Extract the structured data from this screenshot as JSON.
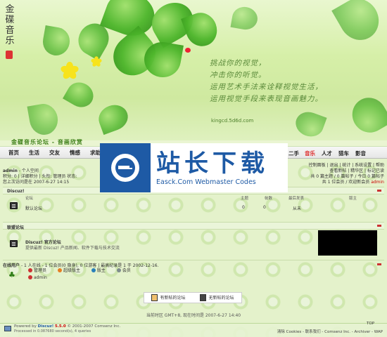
{
  "banner": {
    "logo_vertical": "金碟音乐",
    "slogan_lines": [
      "挑战你的视觉，",
      "冲击你的听觉。",
      "运用艺术手法来诠释视觉生活，",
      "运用视觉手段来表现音画魅力。"
    ],
    "site_url": "kingcd.5d6d.com"
  },
  "title_strip": {
    "text": "金碟音乐论坛 - 音画欣赏"
  },
  "nav": {
    "items": [
      "首页",
      "生活",
      "交友",
      "情感",
      "求助"
    ],
    "right_items": [
      "二手",
      "音乐",
      "人才",
      "猎车",
      "影音"
    ],
    "active": "音乐"
  },
  "watermark": {
    "cn": "站长下载",
    "en": "Easck.Com Webmaster Codes"
  },
  "userbar": {
    "username": "admin",
    "personal_space": "- 个人空间",
    "stats_line": "积分: 0 | 详细积分 | 头衔: 管理员 状态:",
    "last_visit": "您上次访问是在 2007-6-27 14:15",
    "right_links_1": "控制面板 | 退出 | 统计 | 系统设置 | 帮助",
    "right_links_2": "查看新帖 | 精华区 | 标记已读",
    "right_links_3": "共 0 篇主题 / 0 篇帖子 / 今日 0 篇帖子",
    "right_links_4": "共 1 位会员 / 欢迎新会员",
    "new_member": "admin"
  },
  "category1": {
    "title": "Discuz!",
    "col_forum": "论坛",
    "col_topics": "主题",
    "col_posts": "帖数",
    "col_last": "最后发表",
    "col_mod": "版主",
    "forum_name": "默认论坛",
    "topics": "0",
    "posts": "0",
    "last": "从未"
  },
  "category2": {
    "title": "联盟论坛",
    "forum_name": "Discuz! 官方论坛",
    "forum_desc": "提供最新 Discuz! 产品新闻、软件下载与技术交流"
  },
  "online": {
    "title": "在线用户",
    "summary": "- 1 人在线 - 1 位会员(0 隐身), 0 位游客 | 最高纪录是 1 于 2002-12-16.",
    "legend": [
      "管理员",
      "超级版主",
      "版主",
      "会员"
    ],
    "users": [
      "admin"
    ]
  },
  "legend_box": {
    "new": "有新帖的论坛",
    "no_new": "无新帖的论坛"
  },
  "timezone_line": "当前时区 GMT+8, 现在时间是 2007-6-27 14:40",
  "footer": {
    "powered": "Powered by",
    "product": "Discuz!",
    "version": "5.5.0",
    "copyright": "© 2001-2007 Comsenz Inc.",
    "processed": "Processed in 0.087680 second(s), 4 queries",
    "links": "清除 Cookies - 联系我们 - Comsenz Inc. - Archiver - WAP",
    "top": "TOP"
  },
  "colors": {
    "brand_green": "#3a7d14",
    "nav_active": "#d22",
    "watermark_blue": "#1e5aa5"
  }
}
